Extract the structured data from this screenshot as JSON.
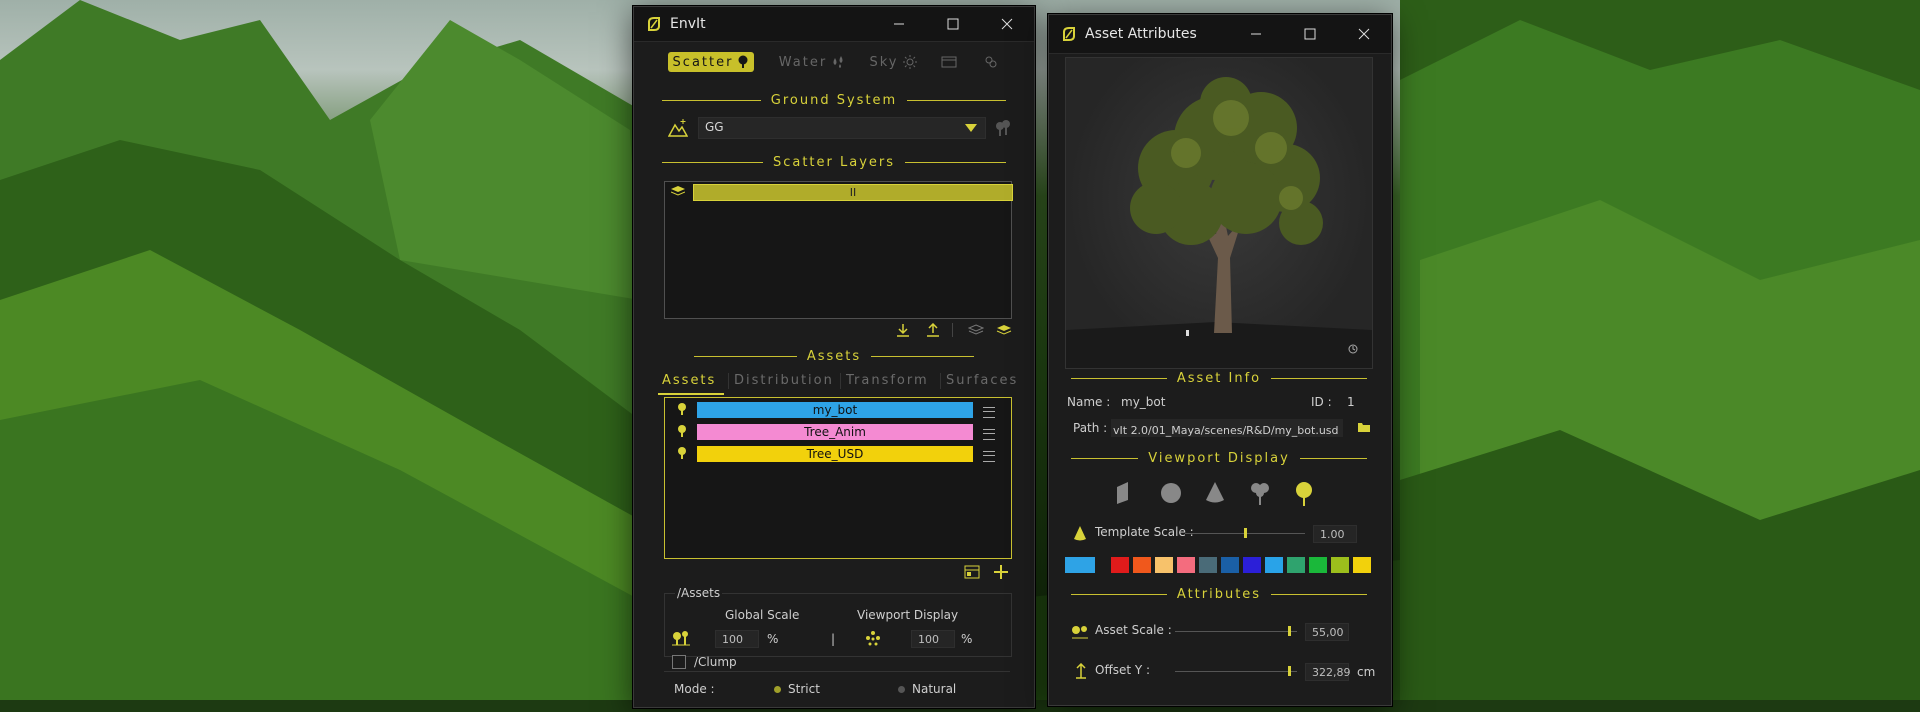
{
  "colors": {
    "accent": "#d8d23a",
    "bg": "#1c1c1c"
  },
  "envit": {
    "title": "EnvIt",
    "tabs": [
      {
        "label": "Scatter",
        "icon": "tree-icon",
        "active": true
      },
      {
        "label": "Water",
        "icon": "water-drops-icon",
        "active": false
      },
      {
        "label": "Sky",
        "icon": "sun-icon",
        "active": false
      },
      {
        "label": "",
        "icon": "window-icon",
        "active": false
      },
      {
        "label": "",
        "icon": "tools-icon",
        "active": false
      }
    ],
    "ground_system": {
      "heading": "Ground System",
      "selected": "GG"
    },
    "scatter_layers": {
      "heading": "Scatter Layers",
      "layer_label": "II"
    },
    "assets_heading": "Assets",
    "asset_tabs": [
      "Assets",
      "Distribution",
      "Transform",
      "Surfaces"
    ],
    "asset_list": [
      {
        "label": "my_bot",
        "color": "#2ea3e6"
      },
      {
        "label": "Tree_Anim",
        "color": "#f48ad2"
      },
      {
        "label": "Tree_USD",
        "color": "#f2d10c"
      }
    ],
    "assets_group": {
      "title": "/Assets",
      "global_scale_label": "Global Scale",
      "global_scale_value": "100",
      "global_scale_unit": "%",
      "separator": "|",
      "viewport_display_label": "Viewport Display",
      "viewport_display_value": "100",
      "viewport_display_unit": "%"
    },
    "clump": {
      "title": "/Clump",
      "mode_label": "Mode :",
      "options": [
        "Strict",
        "Natural"
      ]
    }
  },
  "attrs": {
    "title": "Asset Attributes",
    "asset_info_heading": "Asset Info",
    "name_label": "Name :",
    "name_value": "my_bot",
    "id_label": "ID :",
    "id_value": "1",
    "path_label": "Path :",
    "path_value": "vIt 2.0/01_Maya/scenes/R&D/my_bot.usd",
    "viewport_heading": "Viewport Display",
    "display_icons": [
      "card-icon",
      "sphere-icon",
      "cone-icon",
      "proxy-tree-icon",
      "tree-icon"
    ],
    "template_scale_label": "Template Scale :",
    "template_scale_value": "1.00",
    "template_scale_level": 0.5,
    "palette": [
      "#2ea3e6",
      "#e01b1b",
      "#f0581c",
      "#f7c26b",
      "#f46c7e",
      "#4a6b78",
      "#1a5fa6",
      "#2b1fd8",
      "#29a3e8",
      "#2fa36e",
      "#1ab83a",
      "#9cbe1c",
      "#f2d10c"
    ],
    "attributes_heading": "Attributes",
    "asset_scale_label": "Asset Scale :",
    "asset_scale_value": "55,00",
    "asset_scale_level": 0.95,
    "offset_y_label": "Offset Y :",
    "offset_y_value": "322,89",
    "offset_y_unit": "cm",
    "offset_y_level": 0.95
  }
}
